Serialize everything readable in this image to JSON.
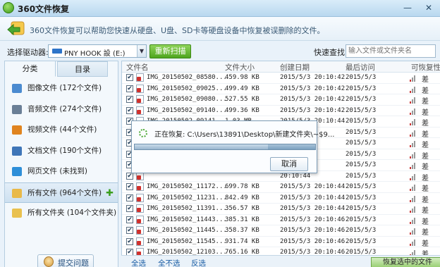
{
  "window": {
    "title": "360文件恢复",
    "minimize_glyph": "—",
    "close_glyph": "✕"
  },
  "header": {
    "description": "360文件恢复可以帮助您快速从硬盘、U盘、SD卡等硬盘设备中恢复被误删除的文件。"
  },
  "drivebar": {
    "label": "选择驱动器:",
    "selected_drive": "PNY HOOK 設 (E:)",
    "rescan_label": "重新扫描",
    "search_label": "快速查找:",
    "search_placeholder": "输入文件或文件夹名"
  },
  "sidebar": {
    "tabs": [
      {
        "label": "分类",
        "active": true
      },
      {
        "label": "目录",
        "active": false
      }
    ],
    "items": [
      {
        "label": "图像文件 (172个文件)",
        "icon": "image-icon",
        "color": "#4b8bd0"
      },
      {
        "label": "音频文件 (274个文件)",
        "icon": "music-note-icon",
        "color": "#6a7f96"
      },
      {
        "label": "视频文件 (44个文件)",
        "icon": "video-icon",
        "color": "#e0841f"
      },
      {
        "label": "文档文件 (190个文件)",
        "icon": "document-icon",
        "color": "#3f76b8"
      },
      {
        "label": "网页文件 (未找到)",
        "icon": "webpage-icon",
        "color": "#2f8fd8"
      },
      {
        "label": "所有文件 (964个文件)",
        "icon": "all-files-icon",
        "color": "#e9b949",
        "selected": true,
        "plus": "✚"
      },
      {
        "label": "所有文件夹 (104个文件夹)",
        "icon": "folder-icon",
        "color": "#e9c14f"
      }
    ],
    "feedback_label": "提交问题"
  },
  "table": {
    "columns": [
      "文件名",
      "文件大小",
      "创建日期",
      "最后访问",
      "可恢复性"
    ],
    "rows": [
      {
        "name": "IMG_20150502_08580...",
        "size": "459.98 KB",
        "created": "2015/5/3  20:10:42",
        "accessed": "2015/5/3",
        "status": "差",
        "checked": true
      },
      {
        "name": "IMG_20150502_09025...",
        "size": "499.49 KB",
        "created": "2015/5/3  20:10:42",
        "accessed": "2015/5/3",
        "status": "差",
        "checked": true
      },
      {
        "name": "IMG_20150502_09080...",
        "size": "527.55 KB",
        "created": "2015/5/3  20:10:42",
        "accessed": "2015/5/3",
        "status": "差",
        "checked": true
      },
      {
        "name": "IMG_20150502_09140...",
        "size": "499.36 KB",
        "created": "2015/5/3  20:10:42",
        "accessed": "2015/5/3",
        "status": "差",
        "checked": true
      },
      {
        "name": "IMG_20150502_09141...",
        "size": "1.03 MB",
        "created": "2015/5/3  20:10:44",
        "accessed": "2015/5/3",
        "status": "差",
        "checked": true
      },
      {
        "name": "",
        "size": "",
        "created": "20:10:44",
        "accessed": "2015/5/3",
        "status": "差",
        "checked": true
      },
      {
        "name": "",
        "size": "",
        "created": "20:10:44",
        "accessed": "2015/5/3",
        "status": "差",
        "checked": true
      },
      {
        "name": "",
        "size": "",
        "created": "20:10:44",
        "accessed": "2015/5/3",
        "status": "差",
        "checked": true
      },
      {
        "name": "",
        "size": "",
        "created": "20:10:44",
        "accessed": "2015/5/3",
        "status": "差",
        "checked": true
      },
      {
        "name": "",
        "size": "",
        "created": "20:10:44",
        "accessed": "2015/5/3",
        "status": "差",
        "checked": true
      },
      {
        "name": "IMG_20150502_11172...",
        "size": "699.78 KB",
        "created": "2015/5/3  20:10:44",
        "accessed": "2015/5/3",
        "status": "差",
        "checked": true
      },
      {
        "name": "IMG_20150502_11231...",
        "size": "842.49 KB",
        "created": "2015/5/3  20:10:44",
        "accessed": "2015/5/3",
        "status": "差",
        "checked": true
      },
      {
        "name": "IMG_20150502_11391...",
        "size": "356.57 KB",
        "created": "2015/5/3  20:10:44",
        "accessed": "2015/5/3",
        "status": "差",
        "checked": true
      },
      {
        "name": "IMG_20150502_11443...",
        "size": "385.31 KB",
        "created": "2015/5/3  20:10:46",
        "accessed": "2015/5/3",
        "status": "差",
        "checked": true
      },
      {
        "name": "IMG_20150502_11445...",
        "size": "358.37 KB",
        "created": "2015/5/3  20:10:46",
        "accessed": "2015/5/3",
        "status": "差",
        "checked": true
      },
      {
        "name": "IMG_20150502_11545...",
        "size": "931.74 KB",
        "created": "2015/5/3  20:10:46",
        "accessed": "2015/5/3",
        "status": "差",
        "checked": true
      },
      {
        "name": "IMG_20150502_12103...",
        "size": "765.16 KB",
        "created": "2015/5/3  20:10:46",
        "accessed": "2015/5/3",
        "status": "差",
        "checked": true
      }
    ],
    "check_glyph": "✔"
  },
  "bottom": {
    "select_all": "全选",
    "select_none": "全不选",
    "invert": "反选",
    "recover_label": "恢复选中的文件"
  },
  "dialog": {
    "message": "正在恢复: C:\\Users\\13891\\Desktop\\新建文件夹\\~$9...",
    "progress": 0.74,
    "cancel_label": "取消"
  },
  "colors": {
    "accent_green": "#4ea51d",
    "link_blue": "#1d5fa5",
    "status_red": "#d0312d"
  }
}
